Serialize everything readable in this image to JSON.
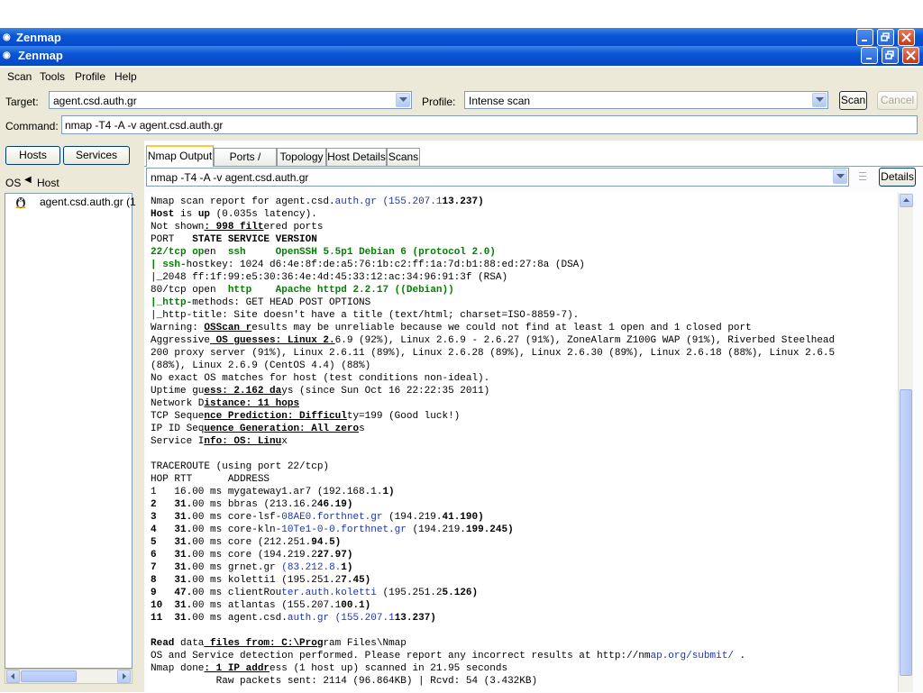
{
  "window": {
    "title_outer": "Zenmap",
    "title_inner": "Zenmap"
  },
  "menu": [
    "Scan",
    "Tools",
    "Profile",
    "Help"
  ],
  "toolbar": {
    "target_label": "Target:",
    "target_value": "agent.csd.auth.gr",
    "profile_label": "Profile:",
    "profile_value": "Intense scan",
    "scan_button": "Scan",
    "cancel_button": "Cancel",
    "command_label": "Command:",
    "command_value": "nmap -T4 -A -v agent.csd.auth.gr"
  },
  "left_panel": {
    "hosts_button": "Hosts",
    "services_button": "Services",
    "col_os": "OS",
    "col_host": "Host",
    "hosts": [
      "agent.csd.auth.gr (1"
    ]
  },
  "tabs": [
    "Nmap Output",
    "Ports / Hosts",
    "Topology",
    "Host Details",
    "Scans"
  ],
  "output_bar": {
    "selected": "nmap -T4 -A -v agent.csd.auth.gr",
    "details_button": "Details"
  },
  "output_lines": [
    [
      [
        "Nmap scan report for agent.csd.",
        ""
      ],
      [
        "auth.gr",
        "bl"
      ],
      [
        " (155.207.1",
        "bl"
      ],
      [
        "13.237)",
        "b"
      ]
    ],
    [
      [
        "Host",
        "b"
      ],
      [
        " is ",
        ""
      ],
      [
        "up",
        "b"
      ],
      [
        " (0.035s latency).",
        ""
      ]
    ],
    [
      [
        "Not shown",
        ""
      ],
      [
        ": 998 filt",
        "u"
      ],
      [
        "ered ports",
        ""
      ]
    ],
    [
      [
        "PORT   ",
        ""
      ],
      [
        "STATE SERVICE VERSION",
        "b"
      ]
    ],
    [
      [
        "22/tcp op",
        "g"
      ],
      [
        "en  ",
        ""
      ],
      [
        "ssh",
        "g"
      ],
      [
        "     ",
        ""
      ],
      [
        "OpenSSH 5.5p1 Debian 6 (protocol 2.0)",
        "g"
      ]
    ],
    [
      [
        "| ssh-",
        "g"
      ],
      [
        "hostkey: 1024 d6:4e:8f:de:a5:76:1b:c2:ff:1a:7d:b1:88:ed:27:8a (DSA)",
        ""
      ]
    ],
    [
      [
        "|_2048 ff:1f:99:e5:30:36:4e:4d:45:33:12:ac:34:96:91:3f (RSA)",
        ""
      ]
    ],
    [
      [
        "80/tcp op",
        ""
      ],
      [
        "en",
        ""
      ],
      [
        "  ",
        ""
      ],
      [
        "http",
        "g"
      ],
      [
        "    ",
        ""
      ],
      [
        "Apache httpd 2.2.17 ((Debian))",
        "g"
      ]
    ],
    [
      [
        "|_http-",
        "g"
      ],
      [
        "methods: GET HEAD POST OPTIONS",
        ""
      ]
    ],
    [
      [
        "|_http-title: Site doesn't have a title (text/html; charset=ISO-8859-7).",
        ""
      ]
    ],
    [
      [
        "Warning: ",
        ""
      ],
      [
        "OSScan r",
        "u"
      ],
      [
        "esults may be unreliable because we could not find at least 1 open and 1 closed port",
        ""
      ]
    ],
    [
      [
        "Aggressive",
        ""
      ],
      [
        " OS guesses: Linux 2.",
        "u"
      ],
      [
        "6.9 (92%), Linux 2.6.9 - 2.6.27 (91%), ZoneAlarm Z100G WAP (91%), Riverbed Steelhead",
        ""
      ]
    ],
    [
      [
        "200 proxy server (91%), Linux 2.6.11 (89%), Linux 2.6.28 (89%), Linux 2.6.30 (89%), Linux 2.6.18 (88%), Linux 2.6.5",
        ""
      ]
    ],
    [
      [
        "(88%), Linux 2.6.9 (CentOS 4.4) (88%)",
        ""
      ]
    ],
    [
      [
        "No exact OS matches for host (test conditions non-ideal).",
        ""
      ]
    ],
    [
      [
        "Uptime gu",
        ""
      ],
      [
        "ess: 2.162 da",
        "u"
      ],
      [
        "ys (since Sun Oct 16 22:22:35 2011)",
        ""
      ]
    ],
    [
      [
        "Network D",
        ""
      ],
      [
        "istance: 11 hops",
        "u"
      ]
    ],
    [
      [
        "TCP Seque",
        ""
      ],
      [
        "nce Prediction: Difficul",
        "u"
      ],
      [
        "ty=199 (Good luck!)",
        ""
      ]
    ],
    [
      [
        "IP ID Seq",
        ""
      ],
      [
        "uence Generation: All zero",
        "u"
      ],
      [
        "s",
        ""
      ]
    ],
    [
      [
        "Service I",
        ""
      ],
      [
        "nfo: OS: Linu",
        "u"
      ],
      [
        "x",
        ""
      ]
    ],
    [
      [
        "",
        ""
      ]
    ],
    [
      [
        "TRACEROUTE (using port 22/tcp)",
        ""
      ]
    ],
    [
      [
        "HOP RTT      ADDRESS",
        ""
      ]
    ],
    [
      [
        "1   16.00 ms mygateway1.ar7 (192.168.1.",
        ""
      ],
      [
        "1)",
        "b"
      ]
    ],
    [
      [
        "2",
        "b"
      ],
      [
        "   ",
        ""
      ],
      [
        "31.",
        "b"
      ],
      [
        "00 ms bbras (213.16.2",
        ""
      ],
      [
        "46.19)",
        "b"
      ]
    ],
    [
      [
        "3",
        "b"
      ],
      [
        "   ",
        ""
      ],
      [
        "31.",
        "b"
      ],
      [
        "00 ms core-lsf-",
        ""
      ],
      [
        "08AE0.forthnet.gr",
        "bl"
      ],
      [
        " (194.219.",
        ""
      ],
      [
        "41.190)",
        "b"
      ]
    ],
    [
      [
        "4",
        "b"
      ],
      [
        "   ",
        ""
      ],
      [
        "31.",
        "b"
      ],
      [
        "00 ms core-kln-",
        ""
      ],
      [
        "10Te1-0-0.forthnet.gr",
        "bl"
      ],
      [
        " (194.219.",
        ""
      ],
      [
        "199.245)",
        "b"
      ]
    ],
    [
      [
        "5",
        "b"
      ],
      [
        "   ",
        ""
      ],
      [
        "31.",
        "b"
      ],
      [
        "00 ms core (212.251.",
        ""
      ],
      [
        "94.5)",
        "b"
      ]
    ],
    [
      [
        "6",
        "b"
      ],
      [
        "   ",
        ""
      ],
      [
        "31.",
        "b"
      ],
      [
        "00 ms core (194.219.2",
        ""
      ],
      [
        "27.97)",
        "b"
      ]
    ],
    [
      [
        "7",
        "b"
      ],
      [
        "   ",
        ""
      ],
      [
        "31.",
        "b"
      ],
      [
        "00 ms grnet.gr ",
        ""
      ],
      [
        "(83.212.8.",
        "bl"
      ],
      [
        "1)",
        "b"
      ]
    ],
    [
      [
        "8",
        "b"
      ],
      [
        "   ",
        ""
      ],
      [
        "31.",
        "b"
      ],
      [
        "00 ms koletti1 (195.251.2",
        ""
      ],
      [
        "7.45)",
        "b"
      ]
    ],
    [
      [
        "9",
        "b"
      ],
      [
        "   ",
        ""
      ],
      [
        "47.",
        "b"
      ],
      [
        "00 ms clientRou",
        ""
      ],
      [
        "ter.auth.koletti",
        "bl"
      ],
      [
        " (195.251.2",
        ""
      ],
      [
        "5.126)",
        "b"
      ]
    ],
    [
      [
        "10",
        "b"
      ],
      [
        "  ",
        ""
      ],
      [
        "31.",
        "b"
      ],
      [
        "00 ms atlantas (155.207.1",
        ""
      ],
      [
        "00.1)",
        "b"
      ]
    ],
    [
      [
        "11",
        "b"
      ],
      [
        "  ",
        ""
      ],
      [
        "31.",
        "b"
      ],
      [
        "00 ms agent.csd.",
        ""
      ],
      [
        "auth.gr",
        "bl"
      ],
      [
        " (155.207.1",
        "bl"
      ],
      [
        "13.237)",
        "b"
      ]
    ],
    [
      [
        "",
        ""
      ]
    ],
    [
      [
        "Read",
        "b"
      ],
      [
        " data",
        ""
      ],
      [
        " files from: C:\\Prog",
        "u"
      ],
      [
        "ram Files\\Nmap",
        ""
      ]
    ],
    [
      [
        "OS and Service detection performed. Please report any incorrect results at http://nm",
        ""
      ],
      [
        "ap.org/submit/",
        "bl"
      ],
      [
        " .",
        ""
      ]
    ],
    [
      [
        "Nmap done",
        ""
      ],
      [
        ": 1 IP addr",
        "u"
      ],
      [
        "ess (1 host up) scanned in 21.95 seconds",
        ""
      ]
    ],
    [
      [
        "           Raw packets sent: 2114 (96.864KB) | Rcvd: 54 (3.432KB)",
        ""
      ]
    ]
  ]
}
